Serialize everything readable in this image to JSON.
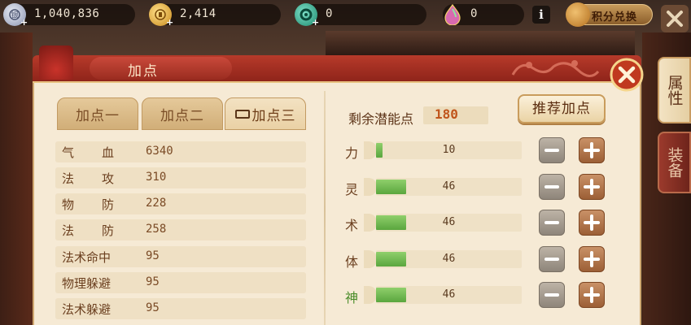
{
  "resources": {
    "silver": "1,040,836",
    "gold": "2,414",
    "jade": "0",
    "gem": "0"
  },
  "topbar": {
    "exchange_label": "积分兑换",
    "info_label": "i"
  },
  "side_tabs": {
    "attributes": "属性",
    "equipment": "装备"
  },
  "panel": {
    "title": "加点"
  },
  "tabs": [
    {
      "label": "加点一"
    },
    {
      "label": "加点二"
    },
    {
      "label": "加点三"
    }
  ],
  "stats": [
    {
      "name": "气血",
      "value": "6340"
    },
    {
      "name": "法攻",
      "value": "310"
    },
    {
      "name": "物防",
      "value": "228"
    },
    {
      "name": "法防",
      "value": "258"
    },
    {
      "name": "法术命中",
      "value": "95"
    },
    {
      "name": "物理躲避",
      "value": "95"
    },
    {
      "name": "法术躲避",
      "value": "95"
    }
  ],
  "points": {
    "remain_label": "剩余潜能点",
    "remain_value": "180",
    "recommend_label": "推荐加点"
  },
  "attributes": [
    {
      "label": "力",
      "value": "10",
      "fill_fraction": 0.045,
      "highlight": false
    },
    {
      "label": "灵",
      "value": "46",
      "fill_fraction": 0.205,
      "highlight": false
    },
    {
      "label": "术",
      "value": "46",
      "fill_fraction": 0.205,
      "highlight": false
    },
    {
      "label": "体",
      "value": "46",
      "fill_fraction": 0.205,
      "highlight": false
    },
    {
      "label": "神",
      "value": "46",
      "fill_fraction": 0.205,
      "highlight": true
    }
  ],
  "colors": {
    "panel_bg": "#f6ead5",
    "header_red": "#b73a2a",
    "bar_green": "#5aa63e",
    "accent_orange": "#c0551c"
  }
}
